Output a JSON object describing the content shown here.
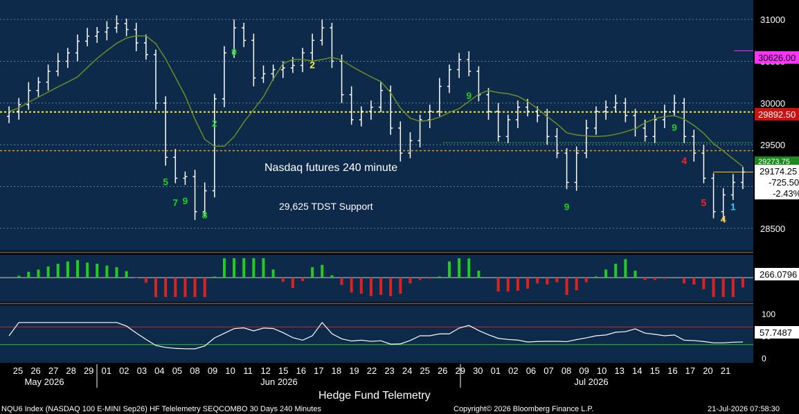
{
  "chart_data": {
    "type": "candlestick",
    "title": "Hedge Fund Telemetry",
    "annotations": [
      "Nasdaq futures 240 minute",
      "29,625 TDST Support"
    ],
    "price_axis": {
      "range": [
        28250,
        31200
      ],
      "ticks": [
        "31000",
        "30500",
        "30000",
        "29500",
        "29000",
        "28500"
      ]
    },
    "price_labels": {
      "upper_level": "30626.00",
      "dotted_level": "29892.50",
      "ma_partial": "29273.75",
      "last": "29174.25",
      "change": "-725.50",
      "change_pct": "-2.43%"
    },
    "price_levels": {
      "upper_level": 30626,
      "dotted_level": 29892.5,
      "orange_dotted": 29430,
      "ma": 29273.75,
      "last": 29174.25,
      "tdst_support": 29625
    },
    "osc_label": "266.0796",
    "rsi": {
      "value_label": "57.7487",
      "ticks": [
        "100",
        "50",
        "0"
      ],
      "overbought": 70,
      "oversold": 30
    },
    "day_labels": [
      "25",
      "26",
      "27",
      "28",
      "29",
      "01",
      "02",
      "03",
      "04",
      "05",
      "08",
      "09",
      "10",
      "11",
      "12",
      "15",
      "16",
      "17",
      "18",
      "19",
      "22",
      "23",
      "24",
      "25",
      "26",
      "29",
      "30",
      "01",
      "02",
      "06",
      "07",
      "08",
      "09",
      "10",
      "13",
      "14",
      "15",
      "16",
      "17",
      "20",
      "21"
    ],
    "month_labels": [
      "May 2026",
      "Jun 2026",
      "Jul 2026"
    ],
    "closes": [
      29900,
      29980,
      30150,
      30250,
      30380,
      30500,
      30600,
      30740,
      30800,
      30850,
      30900,
      30950,
      30880,
      30720,
      30580,
      30000,
      29350,
      29100,
      29120,
      28700,
      28950,
      30050,
      30600,
      30900,
      30750,
      30300,
      30350,
      30400,
      30420,
      30450,
      30600,
      30750,
      30900,
      30500,
      30100,
      29800,
      29900,
      29950,
      30150,
      29700,
      29400,
      29550,
      29800,
      29900,
      30200,
      30400,
      30520,
      30380,
      30100,
      29900,
      29600,
      29800,
      29950,
      29900,
      29850,
      29600,
      29400,
      29050,
      29400,
      29700,
      29900,
      29950,
      30000,
      29850,
      29700,
      29600,
      29800,
      29900,
      30000,
      29600,
      29400,
      29100,
      28700,
      28900,
      29050,
      29174.25
    ],
    "events": [
      {
        "i": 16,
        "label": "5",
        "color": "#22cc22"
      },
      {
        "i": 17,
        "label": "7",
        "color": "#22cc22"
      },
      {
        "i": 18,
        "label": "9",
        "color": "#22cc22"
      },
      {
        "i": 20,
        "label": "8",
        "color": "#22cc22"
      },
      {
        "i": 21,
        "label": "2",
        "color": "#22cc22"
      },
      {
        "i": 23,
        "label": "9",
        "color": "#22cc22"
      },
      {
        "i": 31,
        "label": "2",
        "color": "#ffee44"
      },
      {
        "i": 47,
        "label": "9",
        "color": "#22cc22"
      },
      {
        "i": 57,
        "label": "9",
        "color": "#22cc22"
      },
      {
        "i": 68,
        "label": "9",
        "color": "#22cc22"
      },
      {
        "i": 69,
        "label": "4",
        "color": "#ff2222"
      },
      {
        "i": 71,
        "label": "5",
        "color": "#ff2222"
      },
      {
        "i": 74,
        "label": "1",
        "color": "#33ccff"
      },
      {
        "i": 73,
        "label": "4",
        "color": "#ffcc33"
      }
    ],
    "copyright": "Copyright© 2026 Bloomberg Finance L.P.",
    "footer_left": "NQU6 Index (NASDAQ 100 E-MINI Sep26) HF Telelemetry SEQCOMBO 30 Days 240 Minutes",
    "footer_right": "21-Jul-2026 07:58:30"
  }
}
